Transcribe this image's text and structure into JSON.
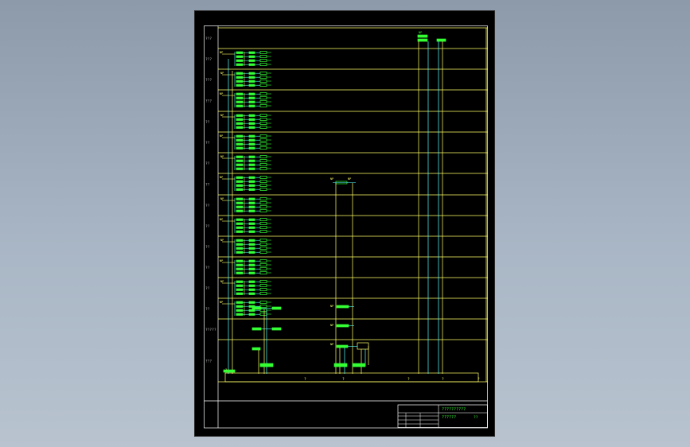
{
  "drawing": {
    "row_labels": [
      "???",
      "???",
      "???",
      "???",
      "??",
      "??",
      "??",
      "??",
      "??",
      "??",
      "??",
      "??",
      "??",
      "??",
      "?????",
      "???"
    ],
    "bus_labels": [
      "?",
      "?",
      "?",
      "?",
      "?"
    ],
    "title_block": {
      "title": "??????????",
      "subtitle": "??????",
      "code": "??"
    },
    "colors": {
      "sheet": "#000000",
      "frame": "#ffffff",
      "grid": "#ffff66",
      "cyan": "#55ffff",
      "green": "#33ff33",
      "dim": "#bbbbbb"
    }
  }
}
